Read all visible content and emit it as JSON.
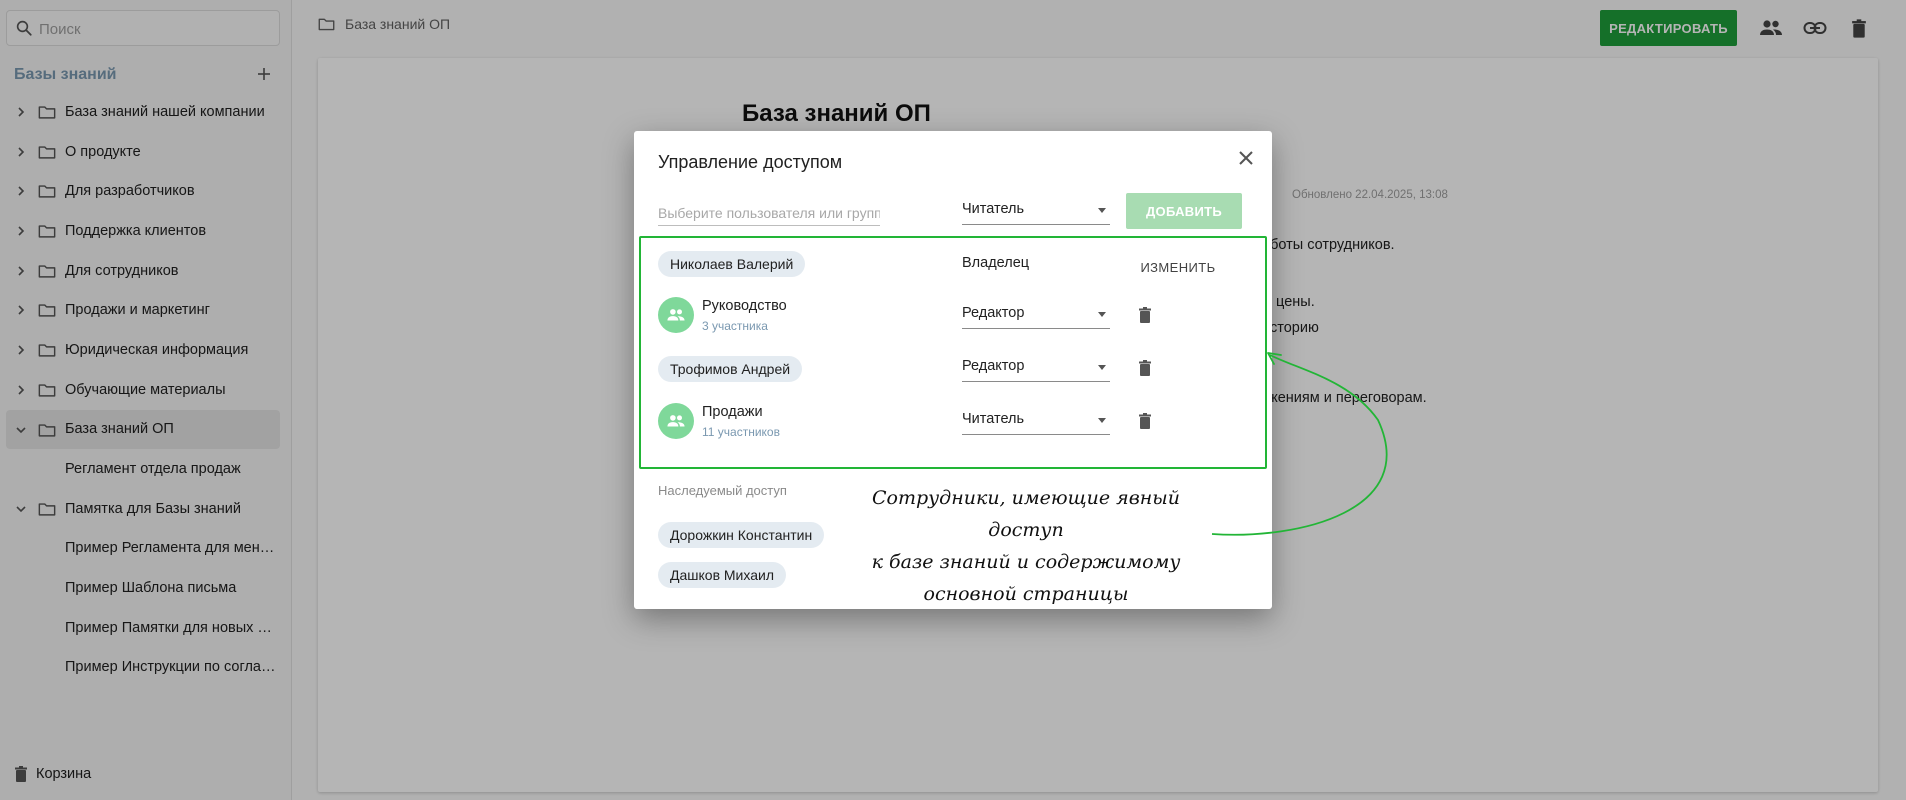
{
  "sidebar": {
    "search_placeholder": "Поиск",
    "section_title": "Базы знаний",
    "items": [
      {
        "label": "База знаний нашей компании",
        "type": "folder",
        "expanded": false
      },
      {
        "label": "О продукте",
        "type": "folder",
        "expanded": false
      },
      {
        "label": "Для разработчиков",
        "type": "folder",
        "expanded": false
      },
      {
        "label": "Поддержка клиентов",
        "type": "folder",
        "expanded": false
      },
      {
        "label": "Для сотрудников",
        "type": "folder",
        "expanded": false
      },
      {
        "label": "Продажи и маркетинг",
        "type": "folder",
        "expanded": false
      },
      {
        "label": "Юридическая информация",
        "type": "folder",
        "expanded": false
      },
      {
        "label": "Обучающие материалы",
        "type": "folder",
        "expanded": false
      },
      {
        "label": "База знаний ОП",
        "type": "folder",
        "expanded": true,
        "active": true
      },
      {
        "label": "Регламент отдела продаж",
        "type": "page"
      },
      {
        "label": "Памятка для Базы знаний",
        "type": "folder",
        "expanded": true
      },
      {
        "label": "Пример Регламента для мен…",
        "type": "page"
      },
      {
        "label": "Пример Шаблона письма",
        "type": "page"
      },
      {
        "label": "Пример Памятки для новых с…",
        "type": "page"
      },
      {
        "label": "Пример Инструкции по согла…",
        "type": "page"
      }
    ],
    "trash_label": "Корзина"
  },
  "header": {
    "breadcrumb": "База знаний ОП",
    "edit_label": "РЕДАКТИРОВАТЬ",
    "icons": [
      "people-icon",
      "link-icon",
      "delete-icon"
    ]
  },
  "document": {
    "title": "База знаний ОП",
    "updated": "Обновлено 22.04.2025, 13:08",
    "visible_fragments": [
      "аботы сотрудников.",
      ", цены.",
      "сторию",
      "жениям и переговорам."
    ]
  },
  "modal": {
    "title": "Управление доступом",
    "user_placeholder": "Выберите пользователя или группу...",
    "default_role": "Читатель",
    "add_label": "ДОБАВИТЬ",
    "explicit_access": [
      {
        "kind": "user",
        "name": "Николаев Валерий",
        "role": "Владелец",
        "action": "ИЗМЕНИТЬ"
      },
      {
        "kind": "group",
        "name": "Руководство",
        "members": "3 участника",
        "role": "Редактор"
      },
      {
        "kind": "user",
        "name": "Трофимов Андрей",
        "role": "Редактор"
      },
      {
        "kind": "group",
        "name": "Продажи",
        "members": "11 участников",
        "role": "Читатель"
      }
    ],
    "inherited_title": "Наследуемый доступ",
    "inherited_access": [
      "Дорожкин Константин",
      "Дашков Михаил"
    ]
  },
  "annotation": {
    "lines": [
      "Сотрудники, имеющие явный доступ",
      "к базе знаний и содержимому",
      "основной страницы"
    ],
    "color": "#22b536"
  },
  "colors": {
    "brand_green": "#1e9e3a",
    "add_disabled": "#a8dcb2",
    "chip_bg": "#e4ebf1",
    "group_avatar": "#7fd89a",
    "sidebar_title": "#7a98b0"
  }
}
